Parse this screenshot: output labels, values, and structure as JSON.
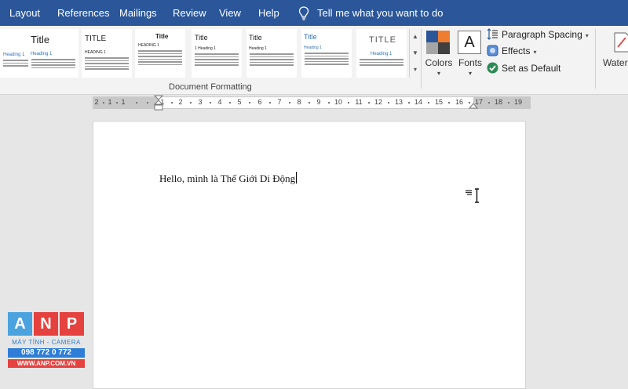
{
  "menubar": {
    "tabs": [
      "Layout",
      "References",
      "Mailings",
      "Review",
      "View",
      "Help"
    ],
    "tell_me": "Tell me what you want to do"
  },
  "ribbon": {
    "style_thumbs": [
      {
        "title": "",
        "heading": "Heading 1"
      },
      {
        "title": "Title",
        "heading": "Heading 1"
      },
      {
        "title": "TITLE",
        "heading": "HEADING 1"
      },
      {
        "title": "Title",
        "heading": "HEADING 1"
      },
      {
        "title": "Title",
        "heading": "1  Heading 1"
      },
      {
        "title": "Title",
        "heading": "Heading 1"
      },
      {
        "title": "Title",
        "heading": "Heading 1"
      },
      {
        "title": "TITLE",
        "heading": "Heading 1"
      }
    ],
    "group_label": "Document Formatting",
    "colors_label": "Colors",
    "fonts_label": "Fonts",
    "fonts_icon_text": "A",
    "paragraph_spacing": "Paragraph Spacing",
    "effects": "Effects",
    "set_as_default": "Set as Default",
    "watermark_label": "Water"
  },
  "ruler": {
    "numbers": [
      "2",
      "1",
      "1",
      "1",
      "2",
      "3",
      "4",
      "5",
      "6",
      "7",
      "8",
      "9",
      "10",
      "11",
      "12",
      "13",
      "14",
      "15",
      "16",
      "17",
      "18",
      "19"
    ]
  },
  "document": {
    "text": "Hello, mình là Thế Giới Di Động"
  },
  "logo": {
    "letters": [
      "A",
      "N",
      "P"
    ],
    "subtitle": "MÁY TÍNH - CAMERA",
    "phone": "098 772 0 772",
    "website": "WWW.ANP.COM.VN"
  },
  "colors": {
    "menubar": "#2b579a",
    "logo_a": "#4aa3df",
    "logo_n": "#e4413f",
    "logo_p": "#e4413f"
  }
}
